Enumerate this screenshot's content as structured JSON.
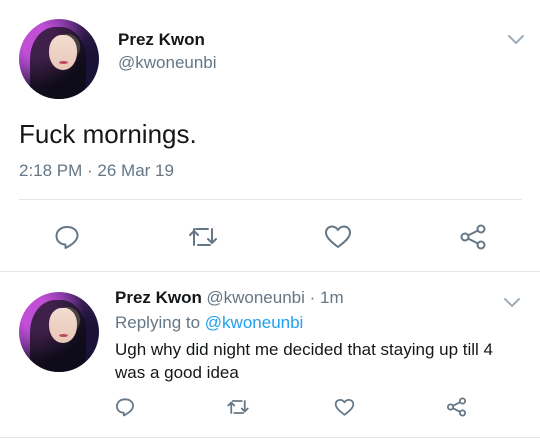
{
  "main_tweet": {
    "display_name": "Prez Kwon",
    "handle": "@kwoneunbi",
    "text": "Fuck mornings.",
    "timestamp": "2:18 PM · 26 Mar 19",
    "actions": [
      "reply-icon",
      "retweet-icon",
      "like-icon",
      "share-icon"
    ]
  },
  "reply_tweet": {
    "display_name": "Prez Kwon",
    "handle_time": "@kwoneunbi · 1m",
    "replying_prefix": "Replying to",
    "replying_to": "@kwoneunbi",
    "text_line1": "Ugh why did night me decided that staying up till 4",
    "text_line2": "was a good idea",
    "actions": [
      "reply-icon",
      "retweet-icon",
      "like-icon",
      "share-icon"
    ]
  },
  "colors": {
    "text": "#14171a",
    "muted": "#657786",
    "link": "#1da1f2",
    "divider": "#e1e8ed"
  }
}
